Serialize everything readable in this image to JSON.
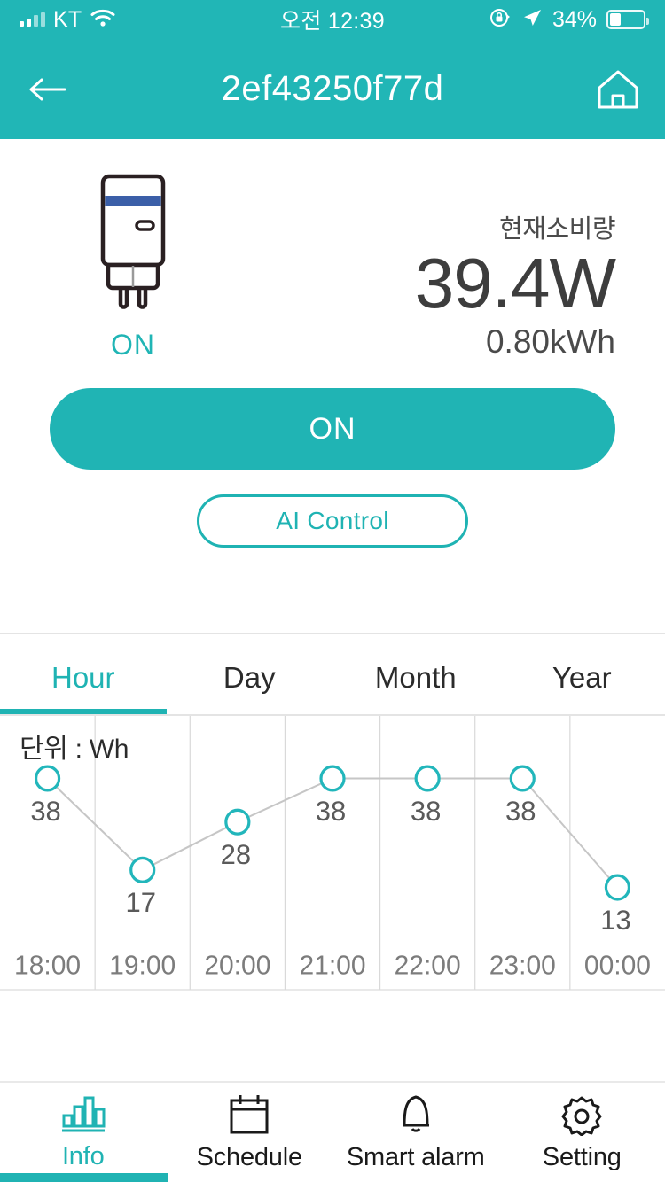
{
  "status_bar": {
    "carrier": "KT",
    "time": "오전 12:39",
    "battery_pct": "34%",
    "battery_level": 34,
    "icons": [
      "signal-bars-icon",
      "wifi-icon",
      "rotation-lock-icon",
      "location-arrow-icon",
      "battery-icon"
    ]
  },
  "header": {
    "title": "2ef43250f77d",
    "back_icon": "back-arrow-icon",
    "home_icon": "home-icon"
  },
  "device": {
    "state_label": "ON",
    "consume_label": "현재소비량",
    "watt": "39.4W",
    "kwh": "0.80kWh",
    "plug_icon": "smart-plug-icon",
    "band_color": "#3b5fa8"
  },
  "controls": {
    "power_button": "ON",
    "ai_button": "AI Control"
  },
  "tabs": [
    {
      "label": "Hour",
      "active": true
    },
    {
      "label": "Day",
      "active": false
    },
    {
      "label": "Month",
      "active": false
    },
    {
      "label": "Year",
      "active": false
    }
  ],
  "chart_data": {
    "type": "line",
    "title": "",
    "unit_label": "단위 : Wh",
    "xlabel": "",
    "ylabel": "Wh",
    "categories": [
      "18:00",
      "19:00",
      "20:00",
      "21:00",
      "22:00",
      "23:00",
      "00:00"
    ],
    "values": [
      38,
      17,
      28,
      38,
      38,
      38,
      13
    ],
    "point_labels": [
      "38",
      "17",
      "28",
      "38",
      "38",
      "38",
      "13"
    ],
    "ylim": [
      0,
      45
    ],
    "grid": true,
    "grid_orientation": "vertical",
    "legend": "none",
    "marker_color": "#22b6bb",
    "line_color": "#c6c6c6"
  },
  "bottom_nav": [
    {
      "label": "Info",
      "icon": "bar-chart-icon",
      "active": true
    },
    {
      "label": "Schedule",
      "icon": "calendar-icon",
      "active": false
    },
    {
      "label": "Smart alarm",
      "icon": "bell-icon",
      "active": false
    },
    {
      "label": "Setting",
      "icon": "gear-icon",
      "active": false
    }
  ],
  "theme": {
    "accent": "#21b6b6",
    "text": "#2b2b2b",
    "muted": "#6b6b6b"
  }
}
